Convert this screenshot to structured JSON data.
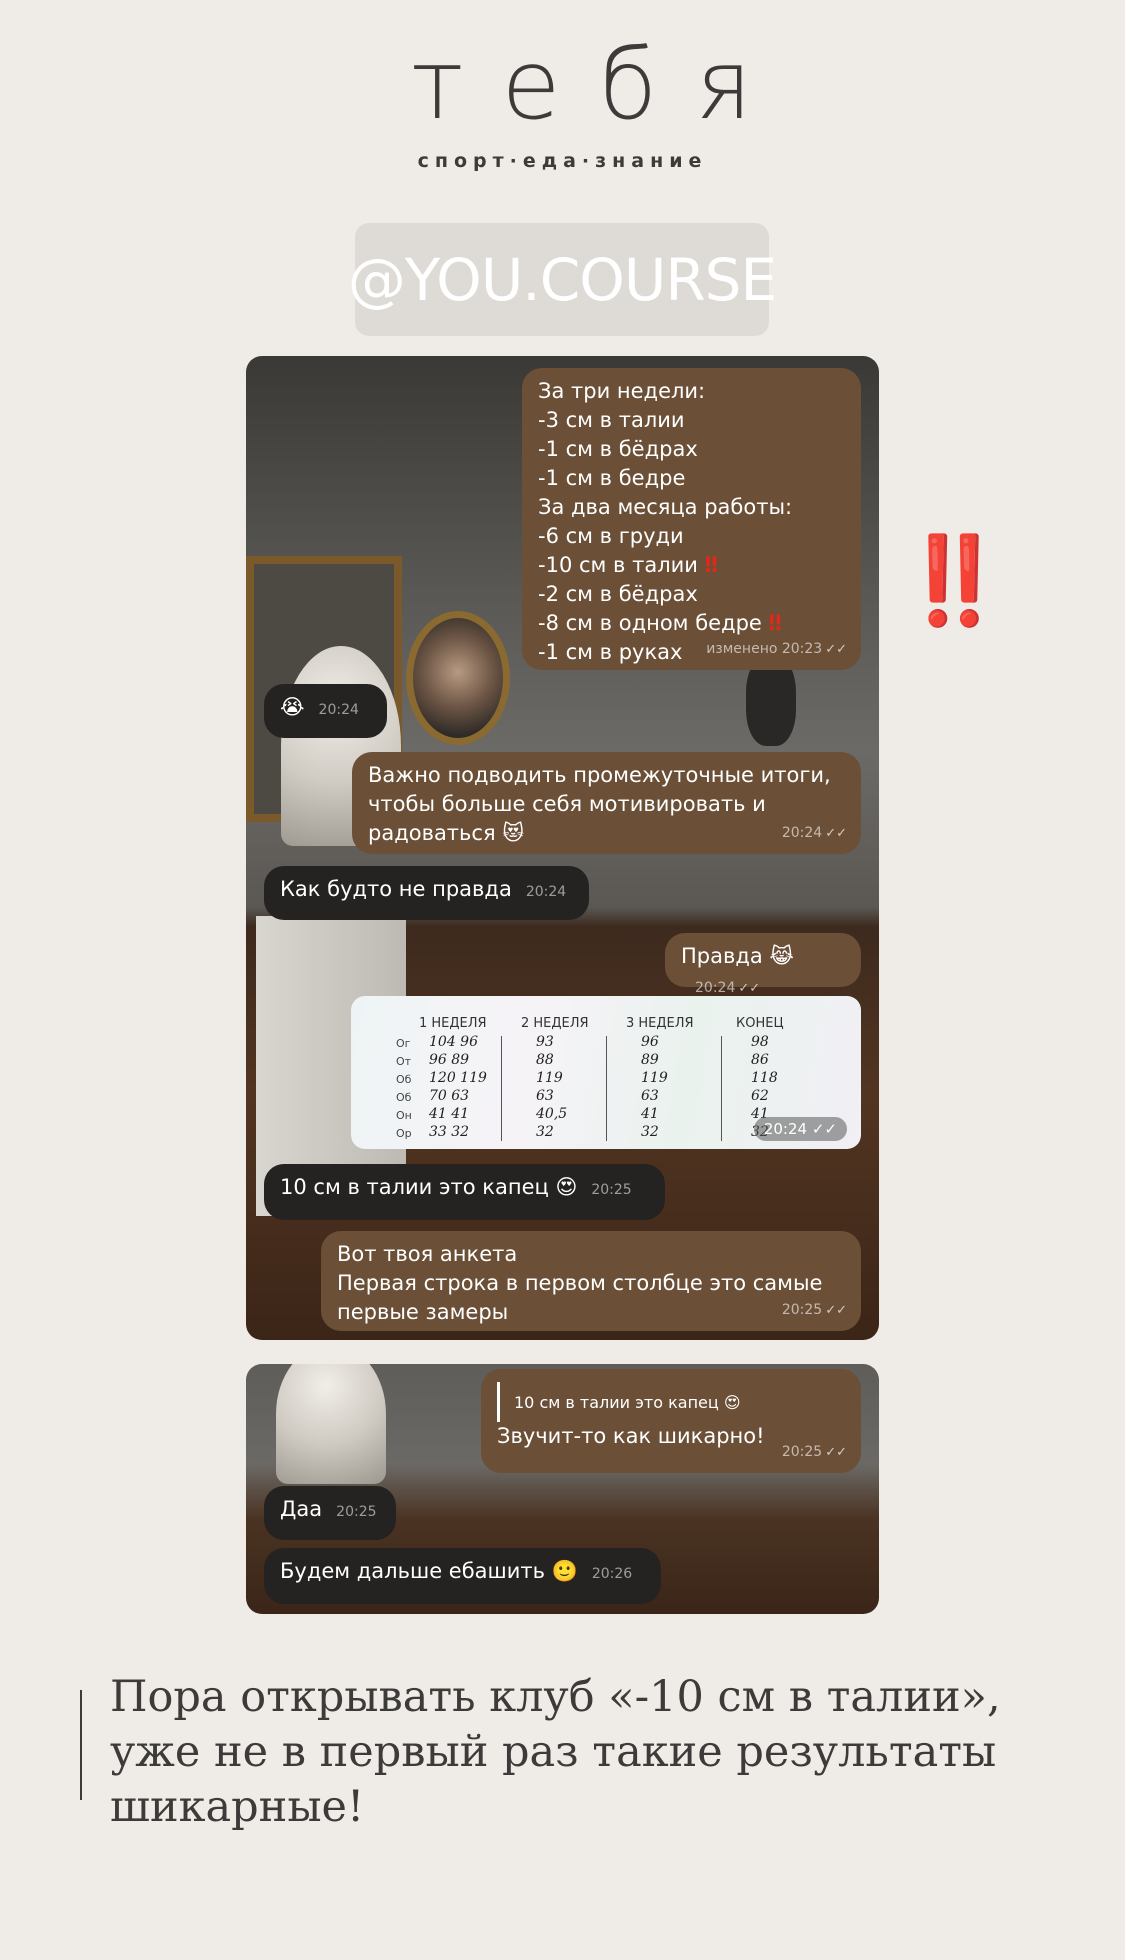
{
  "brand": {
    "logo_text": "тебя",
    "tagline": "спорт·еда·знание",
    "handle": "@YOU.COURSE"
  },
  "accent_color": "#e0281d",
  "chat1": {
    "messages": [
      {
        "side": "out",
        "lines": [
          "За три недели:",
          "-3 см в талии",
          "-1 см в бёдрах",
          "-1 см в бедре",
          "За два месяца работы:",
          "-6 см в груди",
          "-10 см в талии ‼️",
          "-2 см в бёдрах",
          "-8 см в одном бедре ‼️",
          "-1 см в руках"
        ],
        "time": "изменено 20:23"
      },
      {
        "side": "in",
        "text": "😭",
        "time": "20:24"
      },
      {
        "side": "out",
        "lines": [
          "Важно подводить промежуточные итоги,",
          "чтобы больше себя мотивировать и",
          "радоваться 😻"
        ],
        "time": "20:24"
      },
      {
        "side": "in",
        "text": "Как будто не правда",
        "time": "20:24"
      },
      {
        "side": "out",
        "text": "Правда 😹",
        "time": "20:24"
      },
      {
        "side": "out",
        "type": "photo",
        "time": "20:24",
        "sheet": {
          "headers": [
            "1 НЕДЕЛЯ",
            "2 НЕДЕЛЯ",
            "3 НЕДЕЛЯ",
            "КОНЕЦ"
          ],
          "row_labels": [
            "Ог",
            "От",
            "Об",
            "Об",
            "Он",
            "Ор"
          ],
          "col1": [
            "104 96",
            "96 89",
            "120 119",
            "70 63",
            "41 41",
            "33 32"
          ],
          "col2": [
            "93",
            "88",
            "119",
            "63",
            "40,5",
            "32"
          ],
          "col3": [
            "96",
            "89",
            "119",
            "63",
            "41",
            "32"
          ],
          "col4": [
            "98",
            "86",
            "118",
            "62",
            "41",
            "32"
          ]
        }
      },
      {
        "side": "in",
        "text": "10 см в талии это капец 😍",
        "time": "20:25"
      },
      {
        "side": "out",
        "lines": [
          "Вот твоя анкета",
          "Первая строка в первом столбце это самые",
          "первые замеры"
        ],
        "time": "20:25"
      }
    ]
  },
  "chat2": {
    "messages": [
      {
        "side": "out",
        "quote": "10 см в талии это капец 😍",
        "text": "Звучит-то как шикарно!",
        "time": "20:25"
      },
      {
        "side": "in",
        "text": "Даа",
        "time": "20:25"
      },
      {
        "side": "in",
        "text": "Будем дальше ебашить 🙂",
        "time": "20:26"
      }
    ]
  },
  "side_marks": "‼️",
  "caption": "Пора открывать клуб «-10 см в талии», уже не в первый раз такие результаты шикарные!"
}
